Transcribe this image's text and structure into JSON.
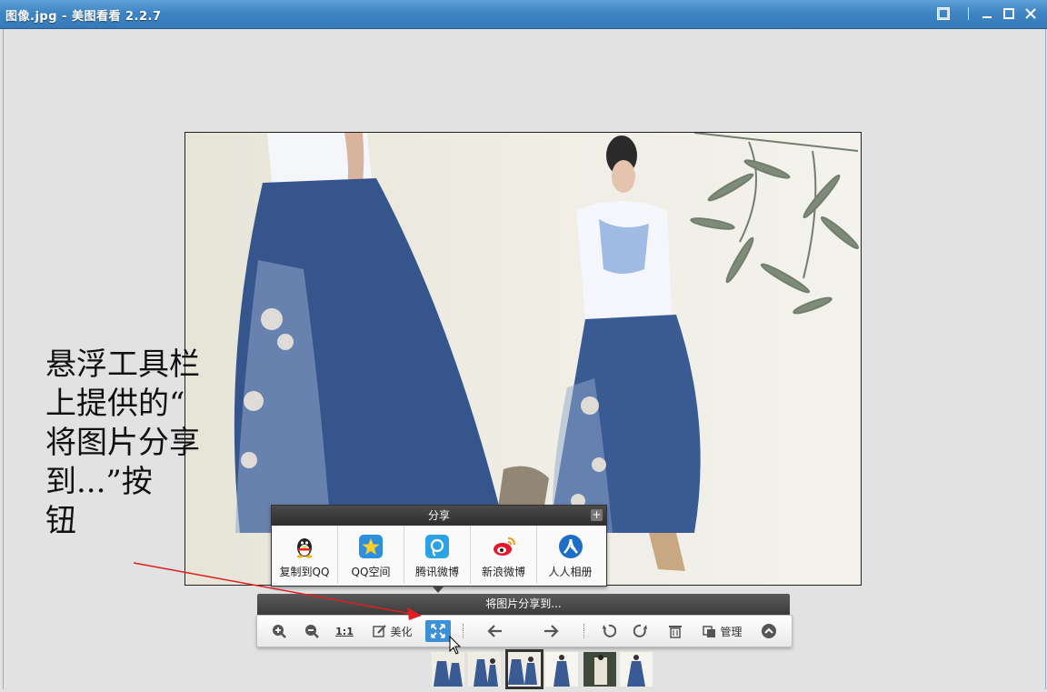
{
  "window": {
    "title": "美图看看 2.2.7",
    "title_prefix_obscured": "图像.jpg -"
  },
  "annotation": {
    "text_lines": [
      "悬浮工具栏",
      "上提供的“",
      "将图片分享",
      "到...”按",
      "钮"
    ]
  },
  "share_panel": {
    "title": "分享",
    "expand_symbol": "+",
    "items": [
      {
        "label": "复制到QQ",
        "icon": "qq-penguin-icon"
      },
      {
        "label": "QQ空间",
        "icon": "qzone-star-icon"
      },
      {
        "label": "腾讯微博",
        "icon": "tencent-weibo-icon"
      },
      {
        "label": "新浪微博",
        "icon": "sina-weibo-icon"
      },
      {
        "label": "人人相册",
        "icon": "renren-icon"
      }
    ]
  },
  "tooltip": {
    "text": "将图片分享到..."
  },
  "toolbar": {
    "zoom_in": "zoom-in-icon",
    "zoom_out": "zoom-out-icon",
    "actual_size_label": "1:1",
    "beautify_label": "美化",
    "manage_label": "管理"
  },
  "colors": {
    "titlebar": "#3f85c4",
    "active_button": "#3d8fd6",
    "arrow": "#e02020",
    "background": "#e2e2e2"
  }
}
